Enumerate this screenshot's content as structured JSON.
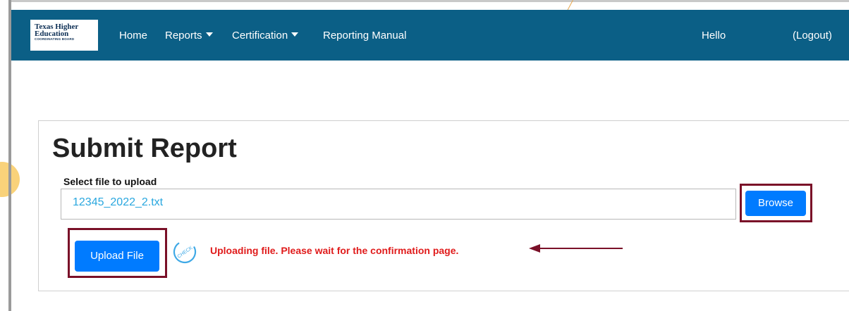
{
  "navbar": {
    "logo": {
      "line1": "Texas Higher",
      "line2": "Education",
      "line3": "COORDINATING BOARD"
    },
    "home": "Home",
    "reports": "Reports",
    "certification": "Certification",
    "reporting_manual": "Reporting Manual",
    "hello": "Hello",
    "logout": "(Logout)",
    "bg_color": "#0b5f86"
  },
  "main": {
    "title": "Submit Report",
    "file_label": "Select file to upload",
    "file_value": "12345_2022_2.txt",
    "browse_label": "Browse",
    "upload_label": "Upload File",
    "status_message": "Uploading file. Please wait for the confirmation page.",
    "spinner_text": "CHECK"
  },
  "colors": {
    "button": "#007bff",
    "highlight": "#7a1028",
    "status": "#e01b1b",
    "file_text": "#29a7df"
  }
}
